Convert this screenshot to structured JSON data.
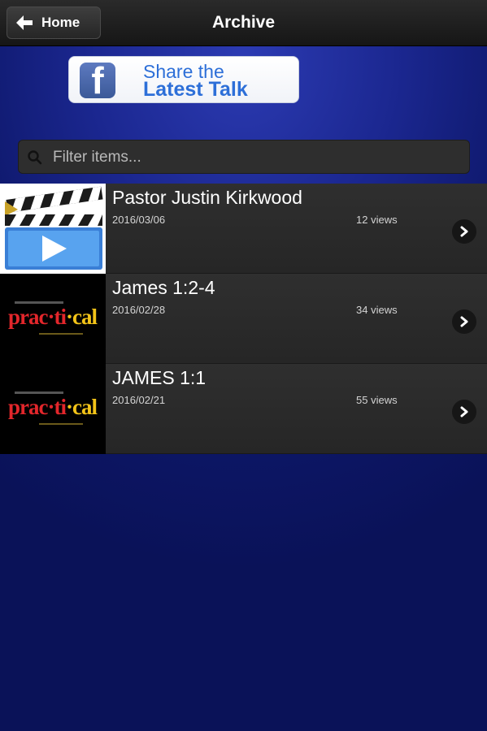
{
  "header": {
    "back_label": "Home",
    "title": "Archive"
  },
  "share_banner": {
    "logo_letter": "f",
    "line1": "Share the",
    "line2": "Latest Talk"
  },
  "filter": {
    "placeholder": "Filter items..."
  },
  "items": [
    {
      "title": "Pastor Justin Kirkwood",
      "date": "2016/03/06",
      "views": "12 views",
      "thumb": "video-clapperboard-icon"
    },
    {
      "title": "James 1:2-4",
      "date": "2016/02/28",
      "views": "34 views",
      "thumb": "practical-series-logo"
    },
    {
      "title": "JAMES 1:1",
      "date": "2016/02/21",
      "views": "55 views",
      "thumb": "practical-series-logo"
    }
  ],
  "practical_logo": {
    "part1": "prac·ti",
    "part2": "·cal"
  },
  "colors": {
    "fb_blue": "#3b5998",
    "share_text": "#2d6fd8",
    "practical_red": "#e2262b",
    "practical_yellow": "#f2c318"
  }
}
